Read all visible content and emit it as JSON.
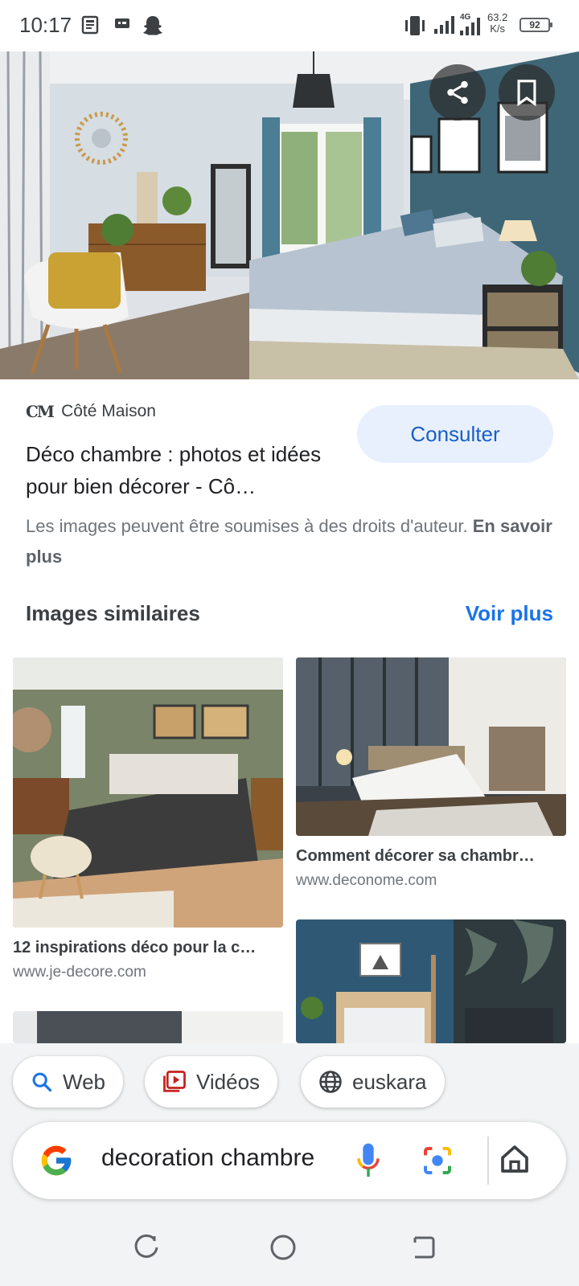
{
  "status_bar": {
    "time": "10:17",
    "network_speed_value": "63.2",
    "network_speed_unit": "K/s",
    "network_type": "4G",
    "battery": "92"
  },
  "hero": {
    "share_icon": "share-icon",
    "bookmark_icon": "bookmark-icon"
  },
  "result": {
    "source_logo": "CM",
    "source_name": "Côté Maison",
    "title": "Déco chambre : photos et idées pour bien décorer - Cô…",
    "consult_label": "Consulter",
    "copyright_text": "Les images peuvent être soumises à des droits d'auteur.",
    "copyright_link": "En savoir plus"
  },
  "similar": {
    "heading": "Images similaires",
    "more_label": "Voir plus",
    "items": [
      {
        "title": "12 inspirations déco pour la c…",
        "domain": "www.je-decore.com"
      },
      {
        "title": "Comment décorer sa chambr…",
        "domain": "www.deconome.com"
      }
    ]
  },
  "chips": [
    {
      "label": "Web",
      "icon": "search-icon"
    },
    {
      "label": "Vidéos",
      "icon": "video-icon"
    },
    {
      "label": "euskara",
      "icon": "globe-icon"
    }
  ],
  "search": {
    "query": "decoration chambre",
    "mic_icon": "mic-icon",
    "lens_icon": "camera-lens-icon",
    "home_icon": "home-icon"
  },
  "colors": {
    "accent_blue": "#1a73e8",
    "chip_bg": "#e8f0fe",
    "panel_bg": "#f1f3f4"
  }
}
